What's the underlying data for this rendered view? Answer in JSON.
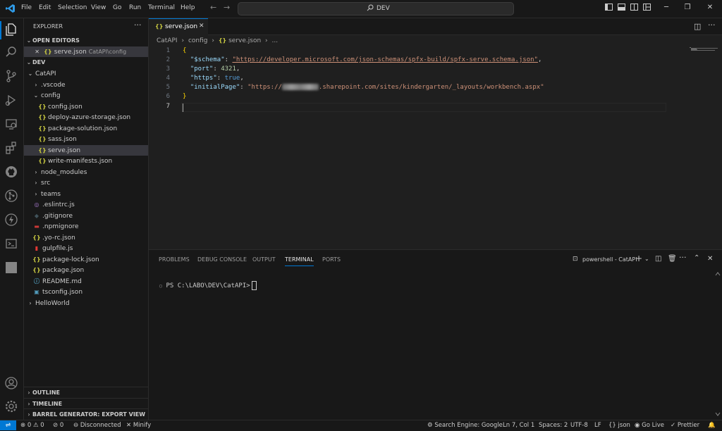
{
  "menu": [
    "File",
    "Edit",
    "Selection",
    "View",
    "Go",
    "Run",
    "Terminal",
    "Help"
  ],
  "search": {
    "text": "DEV"
  },
  "sidebar": {
    "title": "EXPLORER",
    "open_editors_title": "OPEN EDITORS",
    "open_editor": {
      "name": "serve.json",
      "path": "CatAPI\\config"
    },
    "workspace": "DEV",
    "tree": [
      {
        "label": "CatAPI",
        "indent": 1,
        "kind": "folder-open"
      },
      {
        "label": ".vscode",
        "indent": 2,
        "kind": "folder"
      },
      {
        "label": "config",
        "indent": 2,
        "kind": "folder-open"
      },
      {
        "label": "config.json",
        "indent": 3,
        "kind": "json"
      },
      {
        "label": "deploy-azure-storage.json",
        "indent": 3,
        "kind": "json"
      },
      {
        "label": "package-solution.json",
        "indent": 3,
        "kind": "json"
      },
      {
        "label": "sass.json",
        "indent": 3,
        "kind": "json"
      },
      {
        "label": "serve.json",
        "indent": 3,
        "kind": "json",
        "selected": true
      },
      {
        "label": "write-manifests.json",
        "indent": 3,
        "kind": "json"
      },
      {
        "label": "node_modules",
        "indent": 2,
        "kind": "folder"
      },
      {
        "label": "src",
        "indent": 2,
        "kind": "folder"
      },
      {
        "label": "teams",
        "indent": 2,
        "kind": "folder"
      },
      {
        "label": ".eslintrc.js",
        "indent": 2,
        "kind": "eslint"
      },
      {
        "label": ".gitignore",
        "indent": 2,
        "kind": "git"
      },
      {
        "label": ".npmignore",
        "indent": 2,
        "kind": "npm"
      },
      {
        "label": ".yo-rc.json",
        "indent": 2,
        "kind": "json"
      },
      {
        "label": "gulpfile.js",
        "indent": 2,
        "kind": "gulp"
      },
      {
        "label": "package-lock.json",
        "indent": 2,
        "kind": "json"
      },
      {
        "label": "package.json",
        "indent": 2,
        "kind": "json"
      },
      {
        "label": "README.md",
        "indent": 2,
        "kind": "info"
      },
      {
        "label": "tsconfig.json",
        "indent": 2,
        "kind": "ts"
      },
      {
        "label": "HelloWorld",
        "indent": 1,
        "kind": "folder"
      }
    ],
    "bottom_sections": [
      "OUTLINE",
      "TIMELINE",
      "BARREL GENERATOR: EXPORT VIEW"
    ]
  },
  "editor": {
    "tab_label": "serve.json",
    "breadcrumb": [
      "CatAPI",
      "config",
      "serve.json",
      "..."
    ],
    "line_numbers": [
      "1",
      "2",
      "3",
      "4",
      "5",
      "6",
      "7"
    ],
    "code": {
      "open_brace": "{",
      "schema_key": "\"$schema\"",
      "schema_value": "\"https://developer.microsoft.com/json-schemas/spfx-build/spfx-serve.schema.json\"",
      "port_key": "\"port\"",
      "port_value": "4321",
      "https_key": "\"https\"",
      "https_value": "true",
      "page_key": "\"initialPage\"",
      "page_value_prefix": "\"https://",
      "page_value_suffix": ".sharepoint.com/sites/kindergarten/_layouts/workbench.aspx\"",
      "close_brace": "}"
    }
  },
  "panel": {
    "tabs": [
      "PROBLEMS",
      "DEBUG CONSOLE",
      "OUTPUT",
      "TERMINAL",
      "PORTS"
    ],
    "active_tab": "TERMINAL",
    "terminal_name": "powershell - CatAPI",
    "prompt": "PS C:\\LABO\\DEV\\CatAPI>"
  },
  "status": {
    "errors": "0",
    "warnings": "0",
    "ports": "0",
    "connection": "Disconnected",
    "minify": "Minify",
    "search_engine": "Search Engine: Google",
    "position": "Ln 7, Col 1",
    "spaces": "Spaces: 2",
    "encoding": "UTF-8",
    "eol": "LF",
    "language": "json",
    "go_live": "Go Live",
    "prettier": "Prettier"
  },
  "colors": {
    "accent": "#0078d4",
    "json_icon": "#cbcb41",
    "string": "#ce9178",
    "key": "#9cdcfe"
  }
}
